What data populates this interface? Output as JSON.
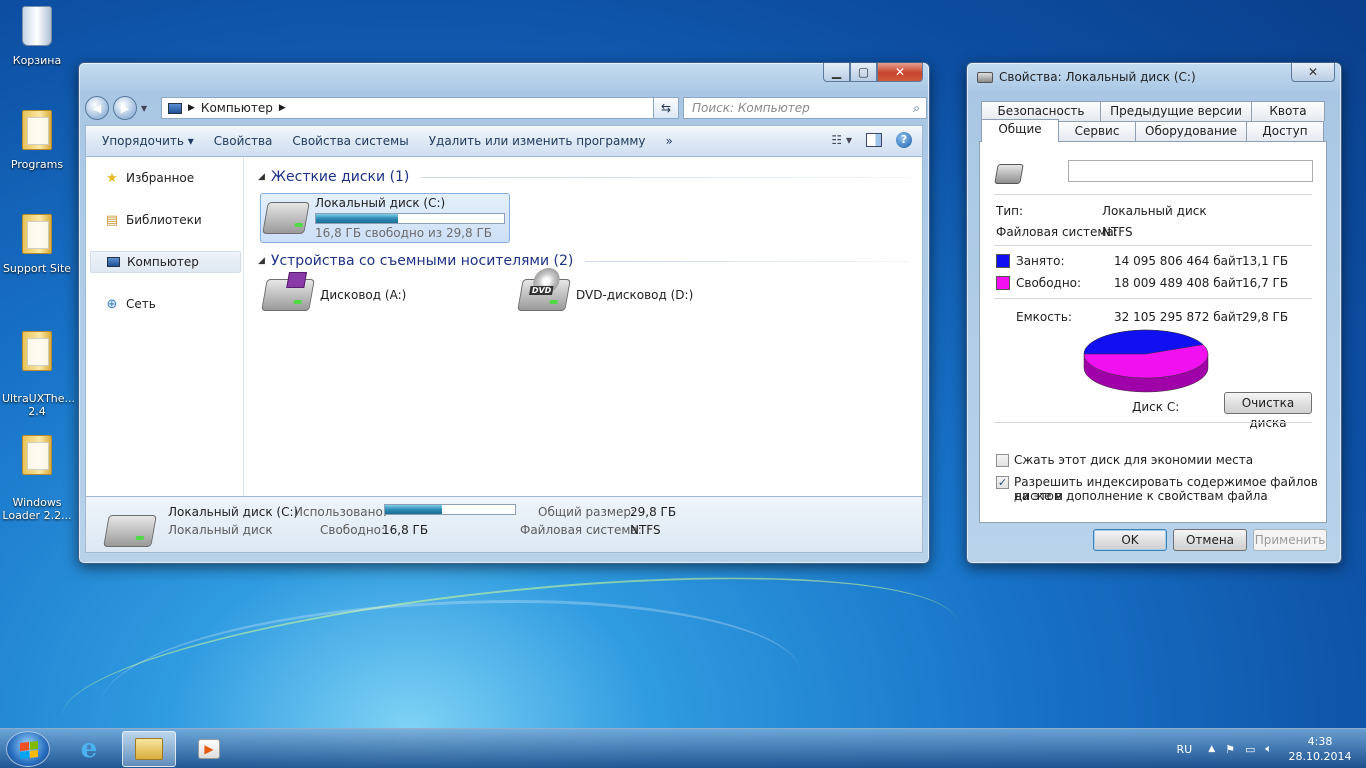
{
  "desktop": {
    "icons": [
      {
        "label": "Корзина",
        "icon": "recycle-bin-icon"
      },
      {
        "label": "Programs",
        "icon": "folder-icon"
      },
      {
        "label": "Support Site",
        "icon": "folder-icon"
      },
      {
        "label": "UltraUXThe...\n2.4",
        "icon": "folder-icon"
      },
      {
        "label": "Windows\nLoader 2.2...",
        "icon": "folder-icon"
      }
    ]
  },
  "explorer": {
    "address": "Компьютер",
    "search_placeholder": "Поиск: Компьютер",
    "toolbar": {
      "organize": "Упорядочить",
      "properties": "Свойства",
      "system_properties": "Свойства системы",
      "uninstall": "Удалить или изменить программу",
      "more": "»"
    },
    "nav": {
      "favorites": "Избранное",
      "libraries": "Библиотеки",
      "computer": "Компьютер",
      "network": "Сеть"
    },
    "groups": {
      "hard_drives": "Жесткие диски (1)",
      "removable": "Устройства со съемными носителями (2)"
    },
    "drive_c": {
      "name": "Локальный диск (C:)",
      "free_text": "16,8 ГБ свободно из 29,8 ГБ",
      "used_fraction": 0.436
    },
    "drive_a": {
      "name": "Дисковод (A:)"
    },
    "drive_d": {
      "name": "DVD-дисковод (D:)",
      "badge": "DVD"
    },
    "details": {
      "title": "Локальный диск (C:)",
      "subtitle": "Локальный диск",
      "used_label": "Использовано:",
      "free_label": "Свободно:",
      "free_value": "16,8 ГБ",
      "total_label": "Общий размер:",
      "total_value": "29,8 ГБ",
      "fs_label": "Файловая система:",
      "fs_value": "NTFS",
      "used_fraction": 0.436
    }
  },
  "props": {
    "title": "Свойства: Локальный диск (C:)",
    "tabs_back": [
      "Безопасность",
      "Предыдущие версии",
      "Квота"
    ],
    "tabs_front": [
      "Общие",
      "Сервис",
      "Оборудование",
      "Доступ"
    ],
    "label_value": "",
    "type_label": "Тип:",
    "type_value": "Локальный диск",
    "fs_label": "Файловая система:",
    "fs_value": "NTFS",
    "used_label": "Занято:",
    "used_bytes": "14 095 806 464 байт",
    "used_gb": "13,1 ГБ",
    "free_label": "Свободно:",
    "free_bytes": "18 009 489 408 байт",
    "free_gb": "16,7 ГБ",
    "capacity_label": "Емкость:",
    "capacity_bytes": "32 105 295 872 байт",
    "capacity_gb": "29,8 ГБ",
    "disk_label": "Диск C:",
    "cleanup": "Очистка диска",
    "compress": "Сжать этот диск для экономии места",
    "index_line1": "Разрешить индексировать содержимое файлов на этом",
    "index_line2": "диске в дополнение к свойствам файла",
    "ok": "OK",
    "cancel": "Отмена",
    "apply": "Применить",
    "used_color": "#1010f0",
    "free_color": "#f010f0"
  },
  "taskbar": {
    "lang": "RU",
    "time": "4:38",
    "date": "28.10.2014"
  }
}
